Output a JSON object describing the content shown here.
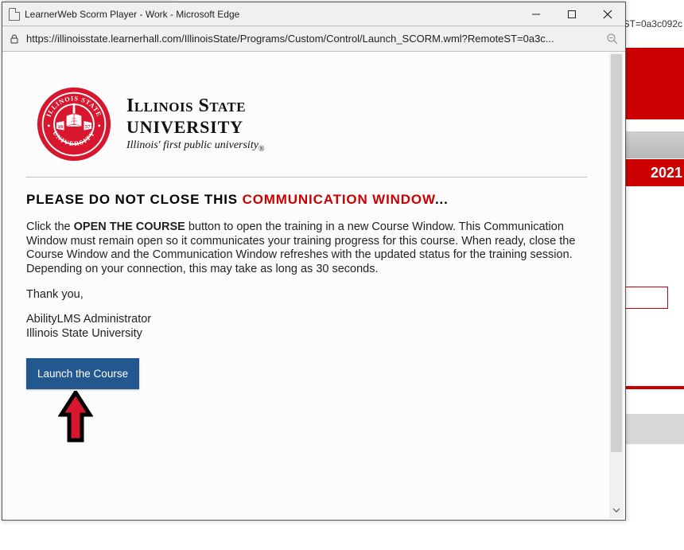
{
  "browser": {
    "window_title": "LearnerWeb Scorm Player - Work - Microsoft Edge",
    "url": "https://illinoisstate.learnerhall.com/IllinoisState/Programs/Custom/Control/Launch_SCORM.wml?RemoteST=0a3c...",
    "background_url_tail": "ST=0a3c092c"
  },
  "university": {
    "name_line1": "Illinois State",
    "name_line2": "UNIVERSITY",
    "tagline": "Illinois' first public university",
    "seal_text_top": "ILLINOIS STATE",
    "seal_text_bottom": "UNIVERSITY",
    "seal_left": "18",
    "seal_right": "57",
    "seal_motto1": "and",
    "seal_motto2": "gladly",
    "seal_motto3": "teche"
  },
  "warning": {
    "prefix": "PLEASE DO NOT CLOSE THIS ",
    "highlight": "COMMUNICATION WINDOW",
    "suffix": "..."
  },
  "body": {
    "p1_prefix": "Click the ",
    "p1_bold": "OPEN THE COURSE",
    "p1_rest": " button to open the training in a new Course Window. This Communication Window must remain open so it communicates your training progress for this course. When ready, close the Course Window and the Communication Window refreshes with the updated status for the training session. Depending on your connection, this may take as long as 30 seconds.",
    "thanks": "Thank you,",
    "sig1": "AbilityLMS Administrator",
    "sig2": "Illinois State University"
  },
  "button": {
    "label": "Launch the Course"
  },
  "background": {
    "year": "2021"
  },
  "truncated_tab": "Illinois State University"
}
